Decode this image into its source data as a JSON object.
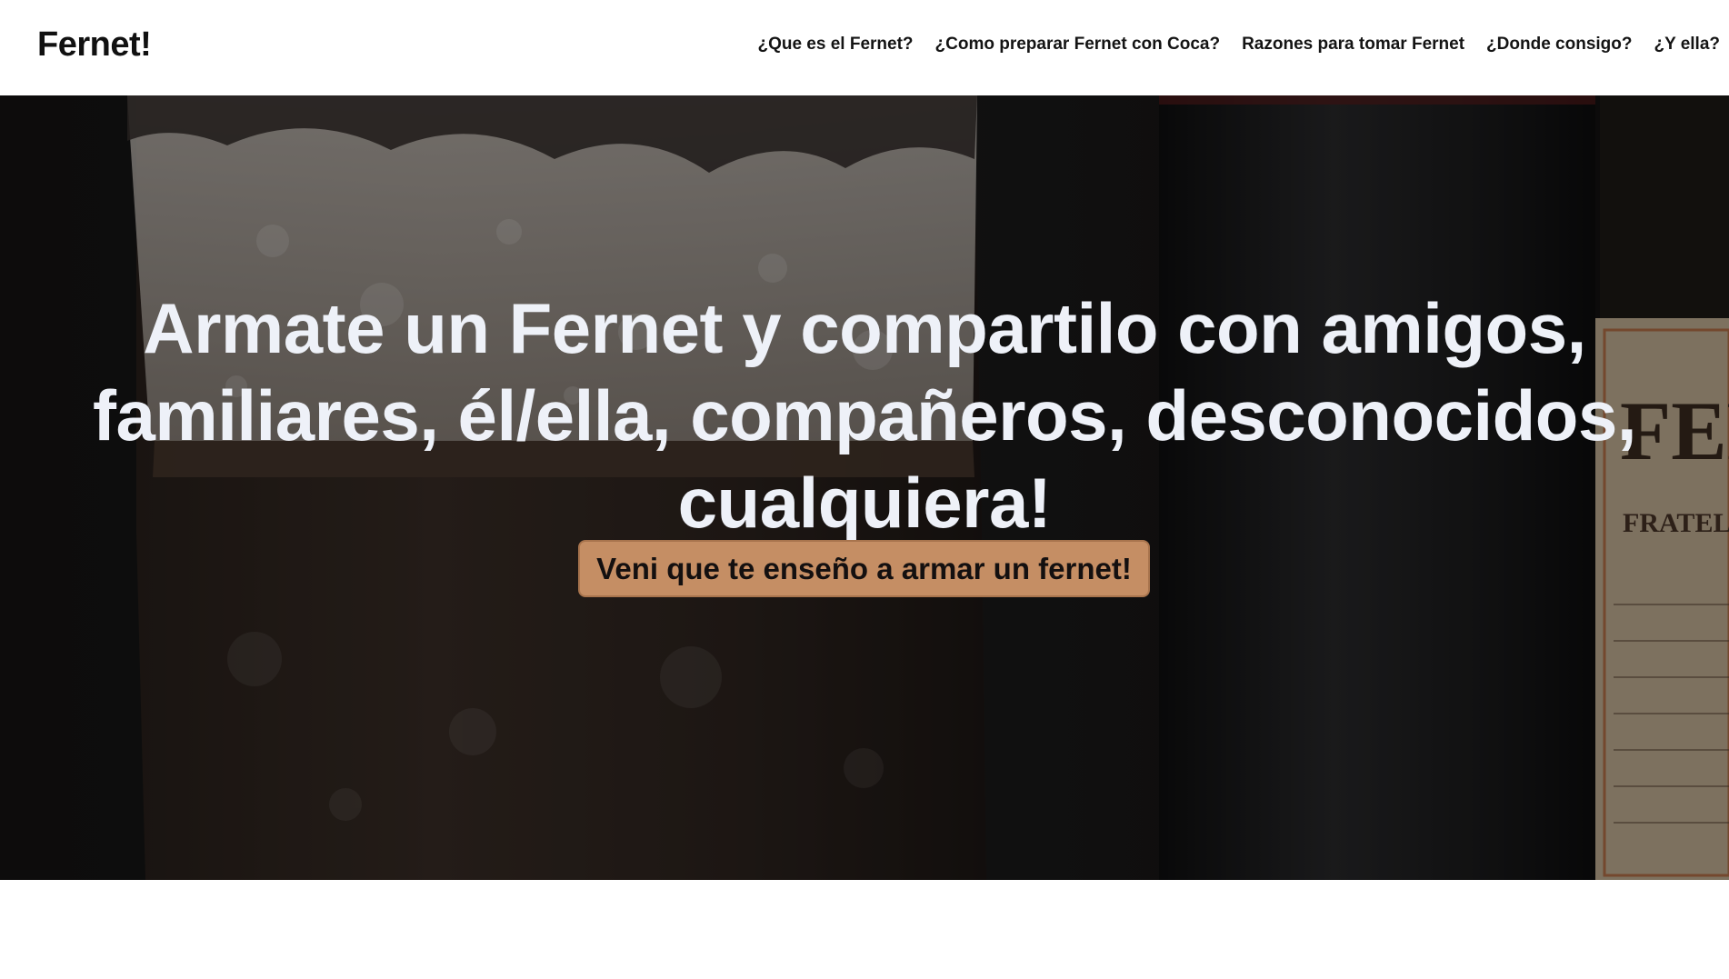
{
  "navbar": {
    "brand": "Fernet!",
    "links": [
      "¿Que es el Fernet?",
      "¿Como preparar Fernet con Coca?",
      "Razones para tomar Fernet",
      "¿Donde consigo?",
      "¿Y ella?"
    ]
  },
  "hero": {
    "title": "Armate un Fernet y compartilo con amigos, familiares, él/ella, compañeros, desconocidos, cualquiera!",
    "cta_label": "Veni que te enseño a armar un fernet!",
    "bottle_label_text": "FERN",
    "bottle_label_subtext": "FRATELLI",
    "colors": {
      "cta_background": "#c58e64",
      "title_text": "#eef1f8",
      "label_paper": "#e9d2b0"
    }
  }
}
